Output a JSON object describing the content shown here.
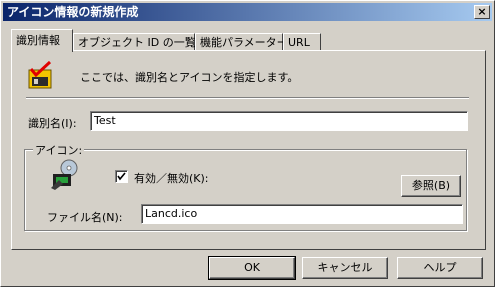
{
  "window": {
    "title": "アイコン情報の新規作成",
    "close_glyph": "×"
  },
  "tabs": [
    {
      "label": "識別情報",
      "active": true
    },
    {
      "label": "オブジェクト ID の一覧",
      "active": false
    },
    {
      "label": "機能パラメーター",
      "active": false
    },
    {
      "label": "URL",
      "active": false
    }
  ],
  "panel": {
    "description": "ここでは、識別名とアイコンを指定します。",
    "identifier": {
      "label": "識別名(I):",
      "value": "Test"
    },
    "icon_group": {
      "caption": "アイコン:",
      "enable_checkbox": {
        "label": "有効／無効(K):",
        "checked": true
      },
      "browse_button": "参照(B)",
      "filename": {
        "label": "ファイル名(N):",
        "value": "Lancd.ico"
      }
    }
  },
  "footer": {
    "ok": "OK",
    "cancel": "キャンセル",
    "help": "ヘルプ"
  },
  "colors": {
    "titlebar_start": "#0a246a",
    "titlebar_end": "#a6caf0",
    "face": "#d4d0c8"
  }
}
